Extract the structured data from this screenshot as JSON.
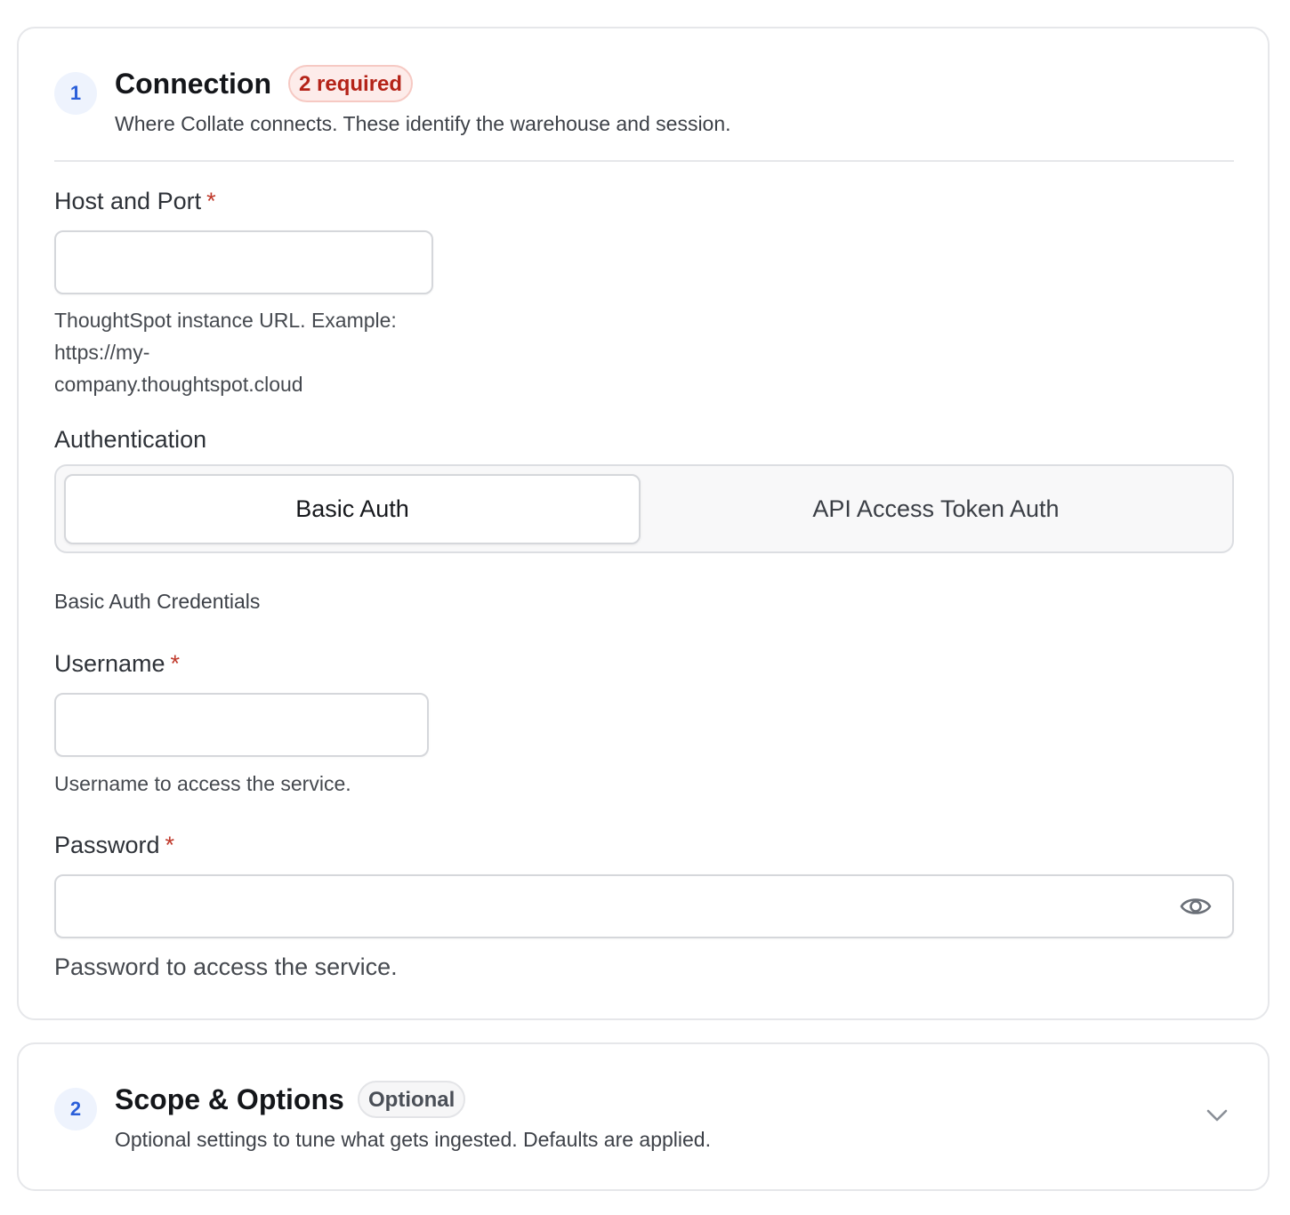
{
  "connection": {
    "step": "1",
    "title": "Connection",
    "badge": "2 required",
    "description": "Where Collate connects. These identify the warehouse and session.",
    "host_port": {
      "label": "Host and Port",
      "required_mark": "*",
      "value": "",
      "help_line1": "ThoughtSpot instance URL. Example:",
      "help_line2": "https://my-",
      "help_line3": "company.thoughtspot.cloud"
    },
    "authentication": {
      "label": "Authentication",
      "options": [
        "Basic Auth",
        "API Access Token Auth"
      ],
      "selected": "Basic Auth"
    },
    "credentials_heading": "Basic Auth Credentials",
    "username": {
      "label": "Username",
      "required_mark": "*",
      "value": "",
      "help": "Username to access the service."
    },
    "password": {
      "label": "Password",
      "required_mark": "*",
      "value": "",
      "help": "Password to access the service.",
      "toggle_icon": "eye-icon"
    }
  },
  "scope": {
    "step": "2",
    "title": "Scope & Options",
    "badge": "Optional",
    "description": "Optional settings to tune what gets ingested. Defaults are applied.",
    "expand_icon": "chevron-down-icon"
  },
  "colors": {
    "accent": "#2b5fd9",
    "required": "#c0392b",
    "required_badge_bg": "#fdecea"
  }
}
